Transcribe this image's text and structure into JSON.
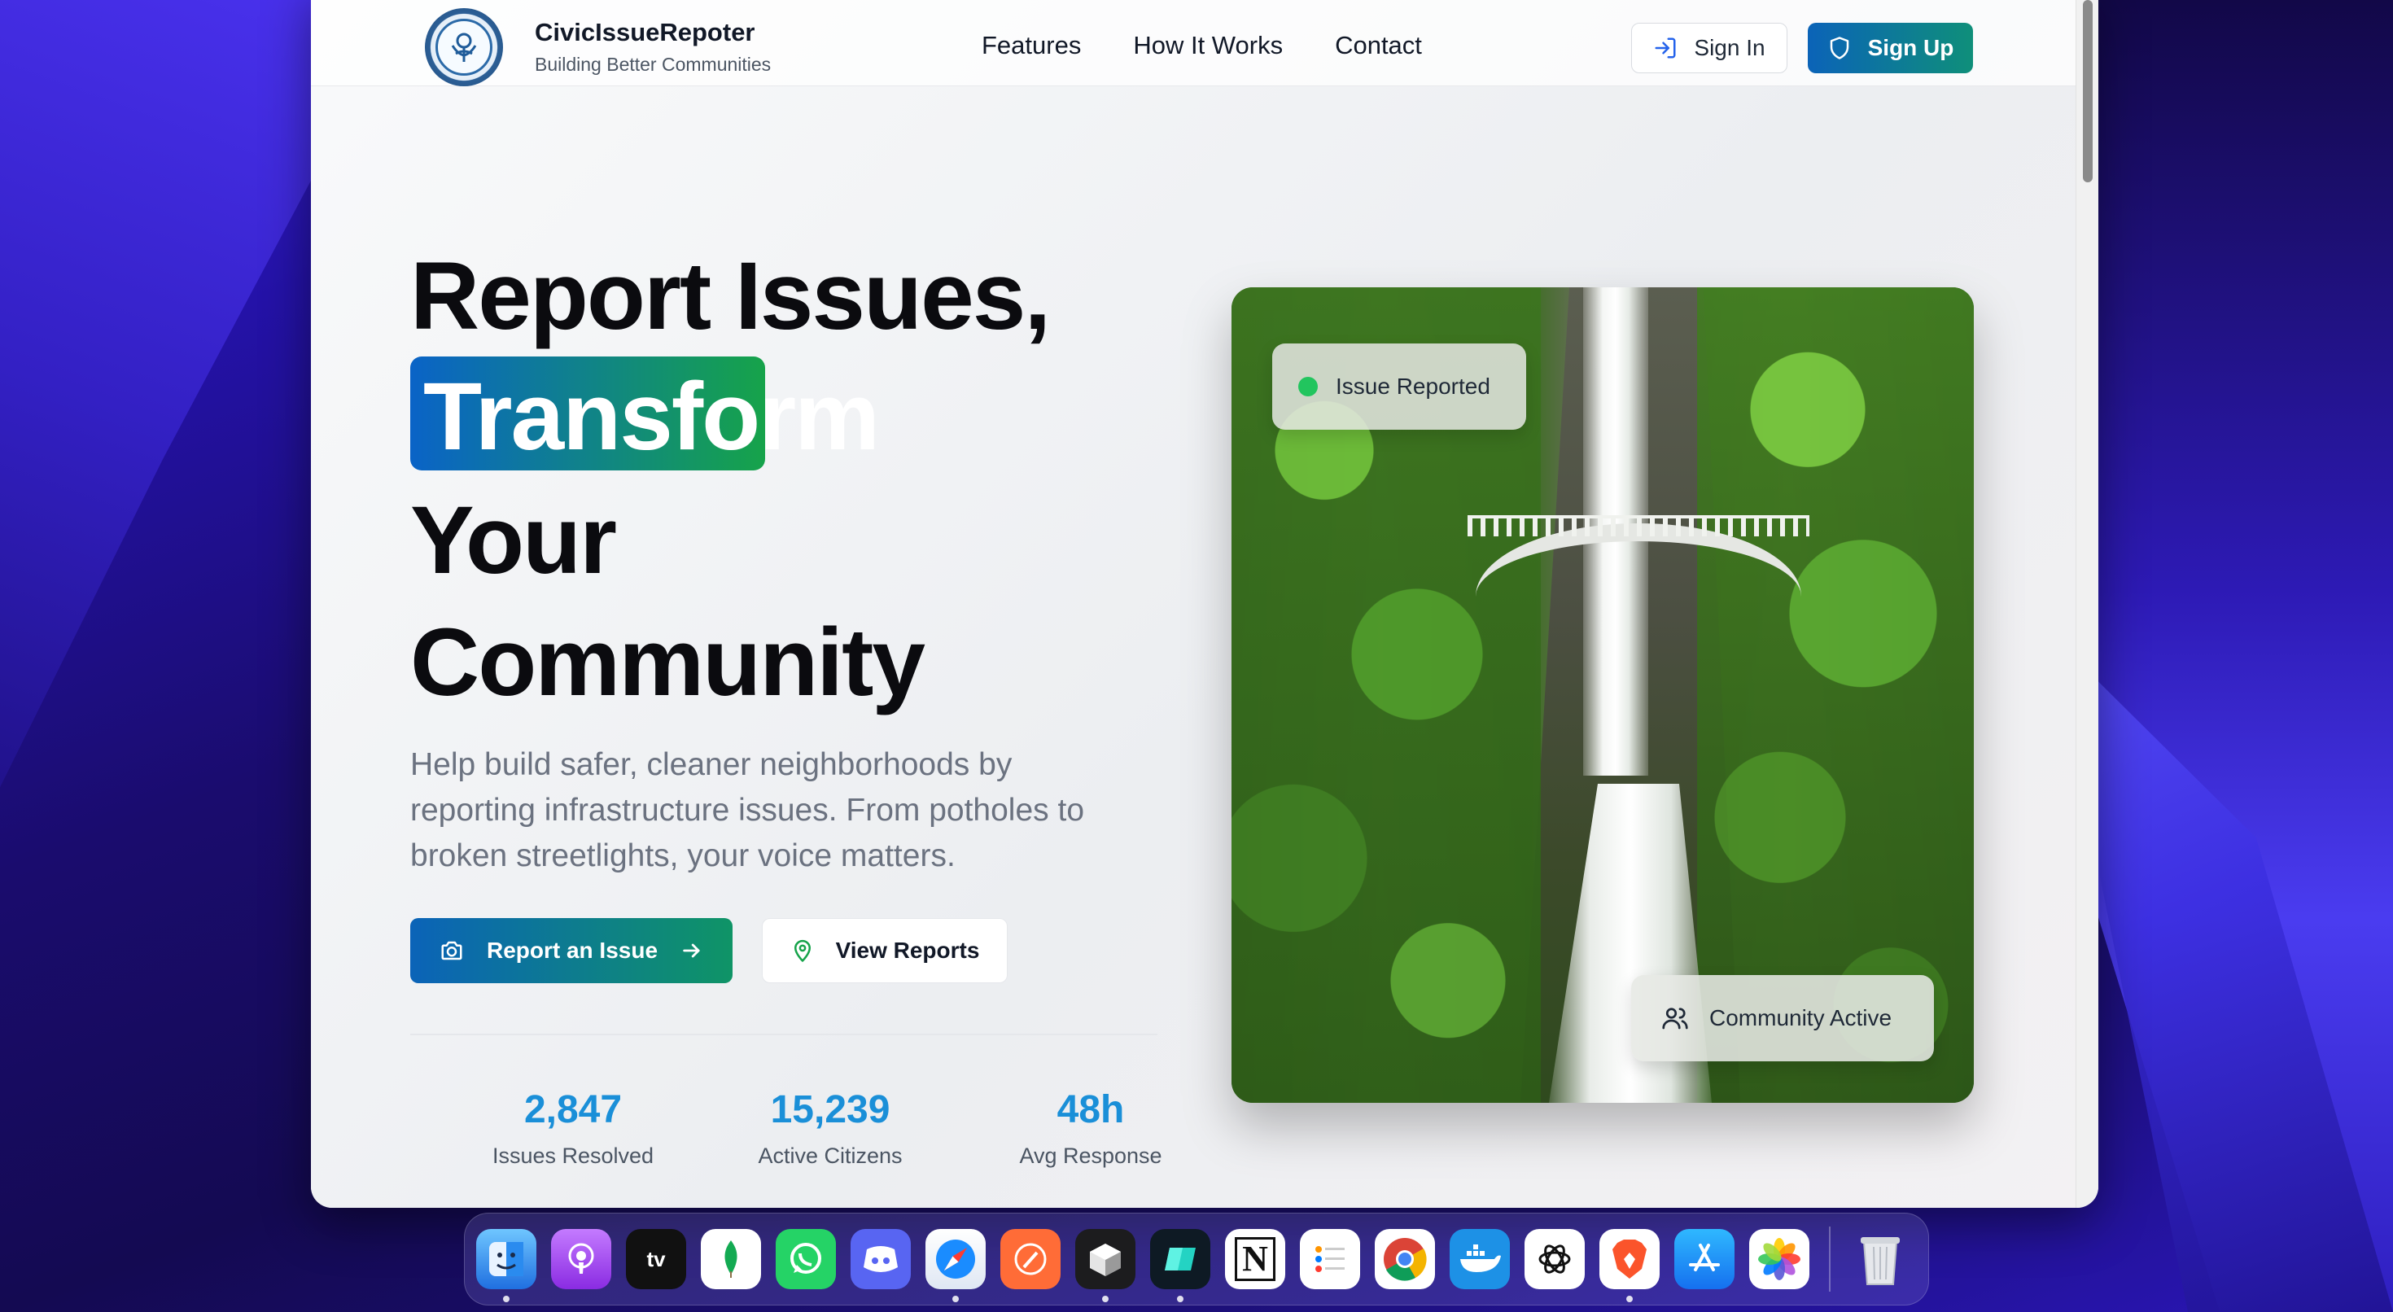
{
  "brand": {
    "title": "CivicIssueRepoter",
    "subtitle": "Building Better Communities"
  },
  "nav": {
    "items": [
      "Features",
      "How It Works",
      "Contact"
    ]
  },
  "auth": {
    "signin_label": "Sign In",
    "signup_label": "Sign Up"
  },
  "hero": {
    "line1": "Report Issues,",
    "highlight": "Transform",
    "line3": "Your",
    "line4": "Community",
    "description": "Help build safer, cleaner neighborhoods by reporting infrastructure issues. From potholes to broken streetlights, your voice matters.",
    "primary_cta": "Report an Issue",
    "secondary_cta": "View Reports"
  },
  "stats": [
    {
      "value": "2,847",
      "label": "Issues Resolved"
    },
    {
      "value": "15,239",
      "label": "Active Citizens"
    },
    {
      "value": "48h",
      "label": "Avg Response"
    }
  ],
  "photo": {
    "chip_top": "Issue Reported",
    "chip_bottom": "Community Active"
  },
  "colors": {
    "brand_gradient_start": "#0b63b8",
    "brand_gradient_end": "#16a34a",
    "stat_value": "#1a8fd8",
    "status_dot": "#22c55e"
  },
  "dock": {
    "apps": [
      "finder-icon",
      "podcasts-icon",
      "apple-tv-icon",
      "mongodb-icon",
      "whatsapp-icon",
      "discord-icon",
      "safari-icon",
      "postman-icon",
      "cube-app-icon",
      "screen-app-icon",
      "notion-icon",
      "reminders-icon",
      "chrome-icon",
      "docker-icon",
      "chatgpt-icon",
      "brave-icon",
      "app-store-icon",
      "photos-icon",
      "trash-icon"
    ],
    "tv_label": "tv",
    "notion_label": "N"
  }
}
